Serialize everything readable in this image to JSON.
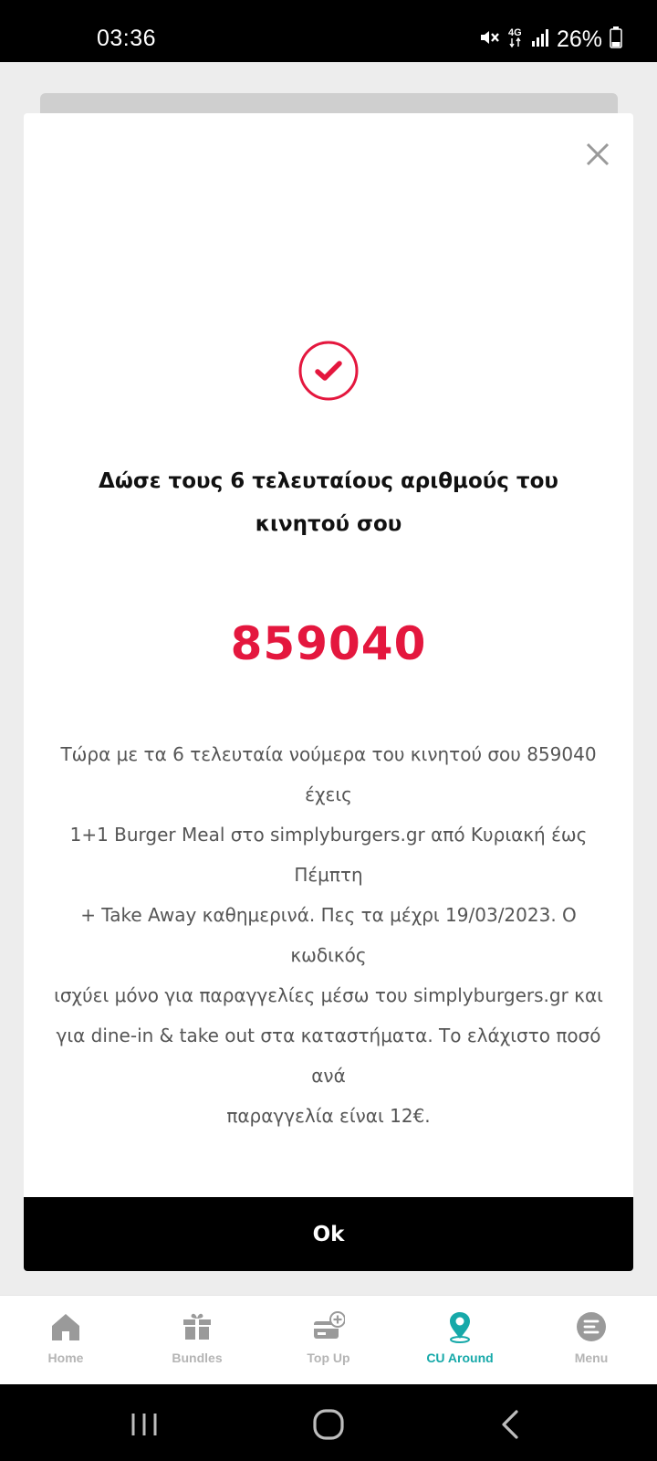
{
  "status_bar": {
    "time": "03:36",
    "network": "4G",
    "battery_pct": "26%",
    "icons": [
      "mute-icon",
      "4g-icon",
      "signal-icon",
      "battery-icon"
    ]
  },
  "modal": {
    "title": "Δώσε τους 6 τελευταίους αριθμούς του κινητού σου",
    "code": "859040",
    "body_lines": [
      "Τώρα με τα 6 τελευταία νούμερα του κινητού σου 859040 έχεις",
      "1+1 Burger Meal στο  simplyburgers.gr από Κυριακή έως Πέμπτη",
      "+ Take Away καθημερινά. Πες τα μέχρι 19/03/2023. Ο κωδικός",
      "ισχύει μόνο για παραγγελίες μέσω του simplyburgers.gr και",
      "για dine-in & take out στα καταστήματα. Το ελάχιστο ποσό ανά",
      "παραγγελία είναι 12€."
    ],
    "ok_label": "Ok",
    "icons": [
      "close-icon",
      "check-circle-icon"
    ]
  },
  "bottom_nav": {
    "items": [
      {
        "label": "Home",
        "icon": "home-icon",
        "active": false
      },
      {
        "label": "Bundles",
        "icon": "gift-box-icon",
        "active": false
      },
      {
        "label": "Top Up",
        "icon": "card-plus-icon",
        "active": false
      },
      {
        "label": "CU Around",
        "icon": "location-pin-icon",
        "active": true
      },
      {
        "label": "Menu",
        "icon": "menu-icon",
        "active": false
      }
    ]
  },
  "colors": {
    "accent_red": "#e4173e",
    "active_teal": "#17a9a9",
    "inactive_gray": "#b5b5b5",
    "ok_button_bg": "#000000"
  },
  "system_nav": {
    "icons": [
      "recents-icon",
      "home-button-icon",
      "back-icon"
    ]
  }
}
